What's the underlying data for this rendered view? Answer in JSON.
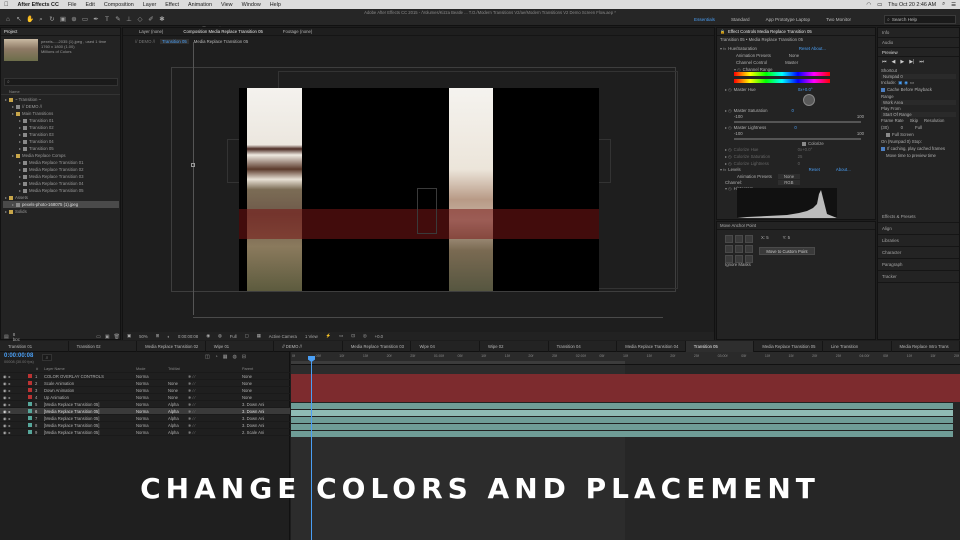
{
  "menubar": {
    "apple": "",
    "app_name": "After Effects CC",
    "items": [
      "File",
      "Edit",
      "Composition",
      "Layer",
      "Effect",
      "Animation",
      "View",
      "Window",
      "Help"
    ],
    "clock": "Thu Oct 20  2:46 AM"
  },
  "window_title": "Adobe After Effects CC 2015 - /Volumes/Kizza Beatle ... T.O./Modern Transitions V2/ae/Modern Transitions V2 Demo Screen Flow.aep *",
  "toolbar": {
    "snapping": "Snapping"
  },
  "workspaces": {
    "items": [
      "Essentials",
      "Standard",
      "App Prototype Laptop",
      "Two Monitor"
    ],
    "search": "Search Help"
  },
  "project": {
    "tab": "Project",
    "thumb_name": "pexels-...-2035 (1).jpeg",
    "thumb_used": "used 1 time",
    "thumb_size": "1760 x 1800 (1.00)",
    "thumb_colors": "Millions of Colors",
    "col_name": "Name",
    "tree": [
      {
        "label": "~ Transition ~",
        "indent": 0,
        "icon": "gold"
      },
      {
        "label": "// DEMO //",
        "indent": 1,
        "icon": "gray"
      },
      {
        "label": "Main Transitions",
        "indent": 1,
        "icon": "gold"
      },
      {
        "label": "Transition 01",
        "indent": 2,
        "icon": "gray"
      },
      {
        "label": "Transition 02",
        "indent": 2,
        "icon": "gray"
      },
      {
        "label": "Transition 03",
        "indent": 2,
        "icon": "gray"
      },
      {
        "label": "Transition 04",
        "indent": 2,
        "icon": "gray"
      },
      {
        "label": "Transition 05",
        "indent": 2,
        "icon": "gray"
      },
      {
        "label": "Media Replace Comps",
        "indent": 1,
        "icon": "gold"
      },
      {
        "label": "Media Replace Transition 01",
        "indent": 2,
        "icon": "gray"
      },
      {
        "label": "Media Replace Transition 02",
        "indent": 2,
        "icon": "gray"
      },
      {
        "label": "Media Replace Transition 03",
        "indent": 2,
        "icon": "gray"
      },
      {
        "label": "Media Replace Transition 04",
        "indent": 2,
        "icon": "gray"
      },
      {
        "label": "Media Replace Transition 05",
        "indent": 2,
        "icon": "gray"
      },
      {
        "label": "Assets",
        "indent": 0,
        "icon": "gold"
      },
      {
        "label": "pexels-photo-168075 (1).jpeg",
        "indent": 1,
        "icon": "gray",
        "selected": true
      },
      {
        "label": "Solids",
        "indent": 0,
        "icon": "gold"
      }
    ],
    "bpc": "8 bpc"
  },
  "viewer": {
    "tabs": {
      "layer": "Layer (none)",
      "composition": "Composition Media Replace Transition 05",
      "footage": "Footage (none)"
    },
    "subtabs": [
      "Transition 05",
      "Media Replace Transition 05"
    ],
    "breadcrumb": "// DEMO //",
    "bottom": {
      "zoom": "50%",
      "timecode": "0:00:00:08",
      "res": "Full",
      "camera": "Active Camera",
      "views": "1 View",
      "exposure": "+0.0"
    }
  },
  "effect_controls": {
    "tab": "Effect Controls Media Replace Transition 05",
    "header": "Transition 05 • Media Replace Transition 05",
    "items": [
      {
        "label": "Hue/Saturation",
        "value": "Reset   About...",
        "type": "section"
      },
      {
        "label": "Animation Presets",
        "value": "None",
        "type": "prop"
      },
      {
        "label": "Channel Control",
        "value": "Master",
        "type": "prop"
      },
      {
        "label": "Channel Range",
        "value": "",
        "type": "section2"
      }
    ],
    "master_hue": {
      "label": "Master Hue",
      "value": "0x+0.0°"
    },
    "master_sat": {
      "label": "Master Saturation",
      "value": "0",
      "min": "-100",
      "max": "100"
    },
    "master_light": {
      "label": "Master Lightness",
      "value": "0",
      "min": "-100",
      "max": "100"
    },
    "colorize": {
      "label": "Colorize",
      "sub": [
        "Colorize Hue",
        "Colorize Saturation",
        "Colorize Lightness"
      ],
      "values": [
        "0x+0.0°",
        "25",
        "0"
      ]
    },
    "levels": {
      "label": "Levels",
      "reset": "Reset",
      "about": "About...",
      "preset_label": "Animation Presets",
      "preset": "None",
      "channel_label": "Channel:",
      "channel": "RGB",
      "histogram": "Histogram"
    },
    "anchor": {
      "tab": "Move Anchor Point",
      "x": "X: 5",
      "y": "Y: 5",
      "button": "Move to Custom Point",
      "ignore": "Ignore Masks"
    }
  },
  "right_panels": {
    "info": "Info",
    "audio": "Audio",
    "preview": "Preview",
    "shortcut_label": "Shortcut",
    "shortcut": "Numpad 0",
    "include": "Include:",
    "cache": "Cache Before Playback",
    "range_label": "Range",
    "range": "Work Area",
    "play_from_label": "Play From",
    "play_from": "Start Of Range",
    "fr_labels": [
      "Frame Rate",
      "Skip",
      "Resolution"
    ],
    "fr_values": [
      "(30)",
      "0",
      "Full"
    ],
    "fullscreen": "Full Screen",
    "stop_label": "On (Numpad 0) Stop:",
    "stop_opts": [
      "If caching, play cached frames",
      "Move time to preview time"
    ],
    "lower": [
      "Effects & Presets",
      "Align",
      "Libraries",
      "Character",
      "Paragraph",
      "Tracker"
    ]
  },
  "timeline": {
    "tabs": [
      "Transition 01",
      "Transition 02",
      "Media Replace Transition 02",
      "Wipe 01",
      "// DEMO //",
      "Media Replace Transition 03",
      "Wipe 04",
      "Wipe 02",
      "Transition 04",
      "Media Replace Transition 04",
      "Transition 05",
      "Media Replace Transition 05",
      "Line Transition",
      "Media Replace Intro Trans"
    ],
    "active_tab": "Transition 05",
    "timecode": "0:00:00:08",
    "fps": "00008 (30.00 fps)",
    "headers": {
      "num": "#",
      "name": "Layer Name",
      "mode": "Mode",
      "trkmat": "TrkMat",
      "parent": "Parent"
    },
    "layers": [
      {
        "n": "1",
        "name": "COLOR OVERLAY CONTROLS",
        "mode": "Norma",
        "trk": "",
        "parent": "None",
        "color": "red"
      },
      {
        "n": "2",
        "name": "Scale Animation",
        "mode": "Norma",
        "trk": "None",
        "parent": "None",
        "color": "red"
      },
      {
        "n": "3",
        "name": "Down Animation",
        "mode": "Norma",
        "trk": "None",
        "parent": "None",
        "color": "red"
      },
      {
        "n": "4",
        "name": "Up Animation",
        "mode": "Norma",
        "trk": "None",
        "parent": "None",
        "color": "red"
      },
      {
        "n": "5",
        "name": "[Media Replace Transition 05]",
        "mode": "Norma",
        "trk": "Alpha",
        "parent": "3. Down Ani",
        "color": "teal"
      },
      {
        "n": "6",
        "name": "[Media Replace Transition 05]",
        "mode": "Norma",
        "trk": "Alpha",
        "parent": "3. Down Ani",
        "color": "teal",
        "selected": true
      },
      {
        "n": "7",
        "name": "[Media Replace Transition 05]",
        "mode": "Norma",
        "trk": "Alpha",
        "parent": "3. Down Ani",
        "color": "teal"
      },
      {
        "n": "8",
        "name": "[Media Replace Transition 05]",
        "mode": "Norma",
        "trk": "Alpha",
        "parent": "3. Down Ani",
        "color": "teal"
      },
      {
        "n": "9",
        "name": "[Media Replace Transition 05]",
        "mode": "Norma",
        "trk": "Alpha",
        "parent": "2. Scale Ani",
        "color": "teal"
      }
    ],
    "ruler": [
      "0f",
      "05f",
      "10f",
      "15f",
      "20f",
      "25f",
      "01:00f",
      "05f",
      "10f",
      "15f",
      "20f",
      "25f",
      "02:00f",
      "05f",
      "10f",
      "15f",
      "20f",
      "25f",
      "03:00f",
      "05f",
      "10f",
      "15f",
      "20f",
      "25f",
      "04:00f",
      "05f",
      "10f",
      "15f",
      "20f"
    ]
  },
  "caption": "CHANGE COLORS AND PLACEMENT"
}
